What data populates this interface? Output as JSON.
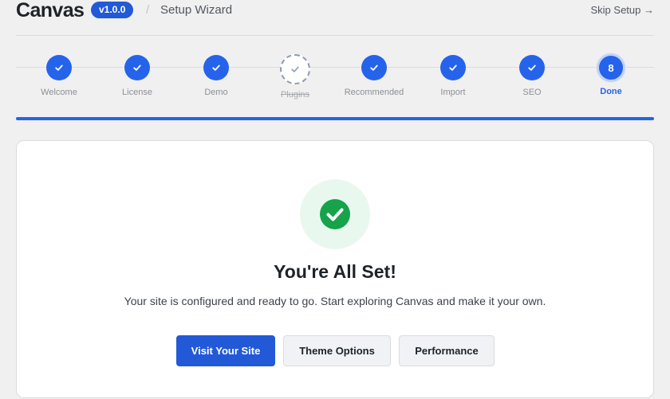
{
  "header": {
    "logo": "Canvas",
    "version": "v1.0.0",
    "separator": "/",
    "title": "Setup Wizard",
    "skip_label": "Skip Setup →"
  },
  "steps": [
    {
      "label": "Welcome",
      "state": "complete"
    },
    {
      "label": "License",
      "state": "complete"
    },
    {
      "label": "Demo",
      "state": "complete"
    },
    {
      "label": "Plugins",
      "state": "skipped"
    },
    {
      "label": "Recommended",
      "state": "complete"
    },
    {
      "label": "Import",
      "state": "complete"
    },
    {
      "label": "SEO",
      "state": "complete"
    },
    {
      "label": "Done",
      "state": "current",
      "number": "8"
    }
  ],
  "progress": 1.0,
  "card": {
    "icon": "check-circle-icon",
    "title": "You're All Set!",
    "subtitle": "Your site is configured and ready to go. Start exploring Canvas and make it your own.",
    "buttons": {
      "visit": "Visit Your Site",
      "theme": "Theme Options",
      "performance": "Performance"
    }
  },
  "colors": {
    "accent": "#2563eb",
    "success": "#16a34a",
    "success_bg": "#e9f8ee"
  }
}
